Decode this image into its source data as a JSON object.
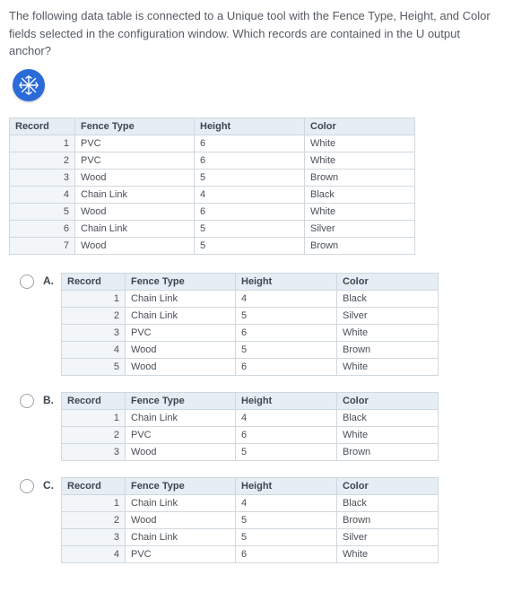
{
  "question": "The following data table is connected to a Unique tool with the Fence Type, Height, and Color fields selected in the configuration window. Which records are contained in the U output anchor?",
  "icon_name": "unique-tool-icon",
  "columns": [
    "Record",
    "Fence Type",
    "Height",
    "Color"
  ],
  "main_rows": [
    {
      "rec": "1",
      "fence": "PVC",
      "height": "6",
      "color": "White"
    },
    {
      "rec": "2",
      "fence": "PVC",
      "height": "6",
      "color": "White"
    },
    {
      "rec": "3",
      "fence": "Wood",
      "height": "5",
      "color": "Brown"
    },
    {
      "rec": "4",
      "fence": "Chain Link",
      "height": "4",
      "color": "Black"
    },
    {
      "rec": "5",
      "fence": "Wood",
      "height": "6",
      "color": "White"
    },
    {
      "rec": "6",
      "fence": "Chain Link",
      "height": "5",
      "color": "Silver"
    },
    {
      "rec": "7",
      "fence": "Wood",
      "height": "5",
      "color": "Brown"
    }
  ],
  "options": [
    {
      "label": "A.",
      "rows": [
        {
          "rec": "1",
          "fence": "Chain Link",
          "height": "4",
          "color": "Black"
        },
        {
          "rec": "2",
          "fence": "Chain Link",
          "height": "5",
          "color": "Silver"
        },
        {
          "rec": "3",
          "fence": "PVC",
          "height": "6",
          "color": "White"
        },
        {
          "rec": "4",
          "fence": "Wood",
          "height": "5",
          "color": "Brown"
        },
        {
          "rec": "5",
          "fence": "Wood",
          "height": "6",
          "color": "White"
        }
      ]
    },
    {
      "label": "B.",
      "rows": [
        {
          "rec": "1",
          "fence": "Chain Link",
          "height": "4",
          "color": "Black"
        },
        {
          "rec": "2",
          "fence": "PVC",
          "height": "6",
          "color": "White"
        },
        {
          "rec": "3",
          "fence": "Wood",
          "height": "5",
          "color": "Brown"
        }
      ]
    },
    {
      "label": "C.",
      "rows": [
        {
          "rec": "1",
          "fence": "Chain Link",
          "height": "4",
          "color": "Black"
        },
        {
          "rec": "2",
          "fence": "Wood",
          "height": "5",
          "color": "Brown"
        },
        {
          "rec": "3",
          "fence": "Chain Link",
          "height": "5",
          "color": "Silver"
        },
        {
          "rec": "4",
          "fence": "PVC",
          "height": "6",
          "color": "White"
        }
      ]
    }
  ]
}
